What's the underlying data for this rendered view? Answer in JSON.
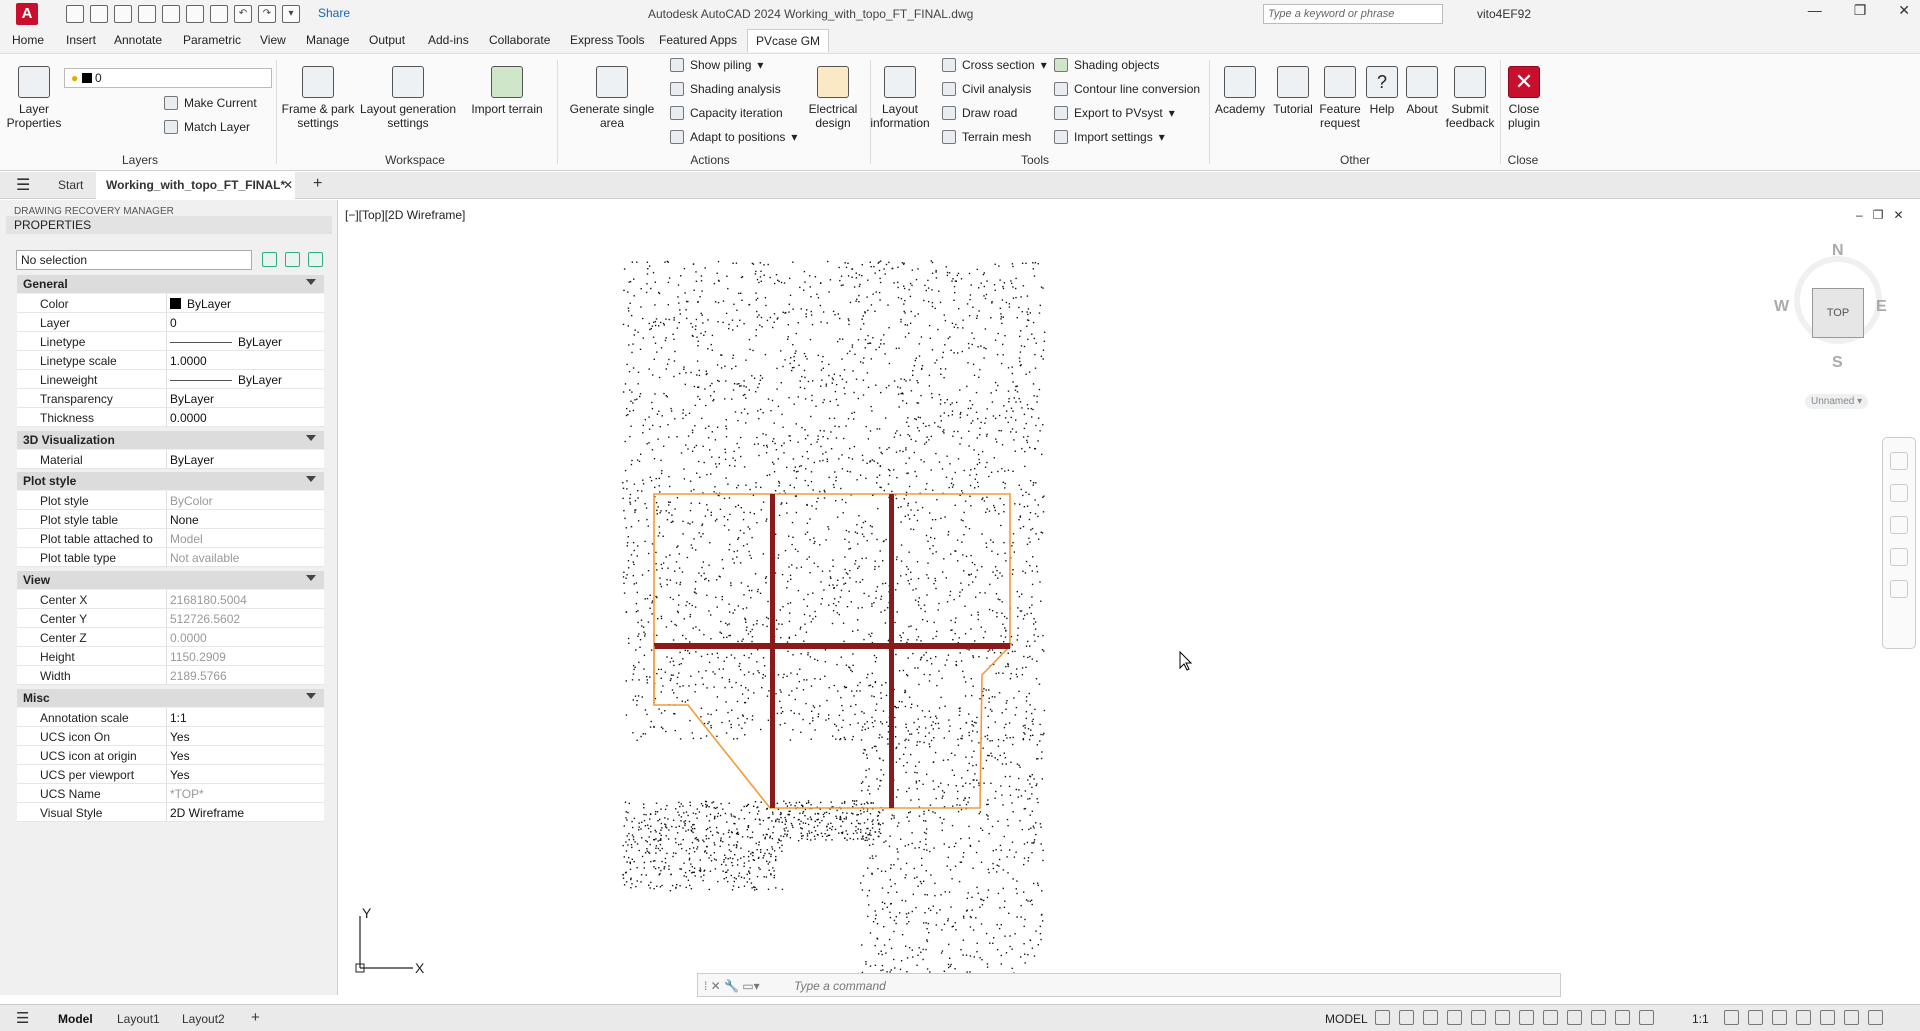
{
  "titlebar": {
    "app_letter": "A",
    "share_label": "Share",
    "title": "Autodesk AutoCAD 2024   Working_with_topo_FT_FINAL.dwg",
    "search_placeholder": "Type a keyword or phrase",
    "user": "vito4EF92"
  },
  "menu_tabs": [
    "Home",
    "Insert",
    "Annotate",
    "Parametric",
    "View",
    "Manage",
    "Output",
    "Add-ins",
    "Collaborate",
    "Express Tools",
    "Featured Apps",
    "PVcase GM"
  ],
  "active_menu_tab": "PVcase GM",
  "ribbon": {
    "layers": {
      "layer_properties": "Layer\nProperties",
      "current_layer": "0",
      "make_current": "Make Current",
      "match_layer": "Match Layer",
      "panel_title": "Layers"
    },
    "workspace": {
      "frame_park": "Frame & park\nsettings",
      "layout_generation": "Layout generation\nsettings",
      "import_terrain": "Import terrain",
      "panel_title": "Workspace"
    },
    "actions": {
      "generate_single_area": "Generate single\narea",
      "show_piling": "Show piling",
      "shading_analysis": "Shading analysis",
      "capacity_iteration": "Capacity iteration",
      "adapt_to_positions": "Adapt to positions",
      "electrical_design": "Electrical\ndesign",
      "panel_title": "Actions"
    },
    "tools": {
      "layout_information": "Layout\ninformation",
      "cross_section": "Cross section",
      "civil_analysis": "Civil analysis",
      "draw_road": "Draw road",
      "terrain_mesh": "Terrain mesh",
      "shading_objects": "Shading objects",
      "contour_line_conversion": "Contour line conversion",
      "export_to_pvsyst": "Export to PVsyst",
      "import_settings": "Import settings",
      "panel_title": "Tools"
    },
    "other": {
      "academy": "Academy",
      "tutorial": "Tutorial",
      "feature_request": "Feature\nrequest",
      "help": "Help",
      "about": "About",
      "submit_feedback": "Submit\nfeedback",
      "panel_title": "Other"
    },
    "close": {
      "close_plugin": "Close\nplugin",
      "panel_title": "Close"
    }
  },
  "file_tabs": {
    "start": "Start",
    "active": "Working_with_topo_FT_FINAL*"
  },
  "properties": {
    "drm": "DRAWING RECOVERY MANAGER",
    "header": "PROPERTIES",
    "selection": "No selection",
    "categories": {
      "general": "General",
      "viz": "3D Visualization",
      "plot": "Plot style",
      "view": "View",
      "misc": "Misc"
    },
    "rows": {
      "color": [
        "Color",
        "ByLayer"
      ],
      "layer": [
        "Layer",
        "0"
      ],
      "linetype": [
        "Linetype",
        "ByLayer"
      ],
      "ltscale": [
        "Linetype scale",
        "1.0000"
      ],
      "lineweight": [
        "Lineweight",
        "ByLayer"
      ],
      "transparency": [
        "Transparency",
        "ByLayer"
      ],
      "thickness": [
        "Thickness",
        "0.0000"
      ],
      "material": [
        "Material",
        "ByLayer"
      ],
      "plotstyle": [
        "Plot style",
        "ByColor"
      ],
      "plotstyletable": [
        "Plot style table",
        "None"
      ],
      "plottableattached": [
        "Plot table attached to",
        "Model"
      ],
      "plottabletype": [
        "Plot table type",
        "Not available"
      ],
      "centerx": [
        "Center X",
        "2168180.5004"
      ],
      "centery": [
        "Center Y",
        "512726.5602"
      ],
      "centerz": [
        "Center Z",
        "0.0000"
      ],
      "height": [
        "Height",
        "1150.2909"
      ],
      "width": [
        "Width",
        "2189.5766"
      ],
      "annoscale": [
        "Annotation scale",
        "1:1"
      ],
      "ucsiconon": [
        "UCS icon On",
        "Yes"
      ],
      "ucsiconorigin": [
        "UCS icon at origin",
        "Yes"
      ],
      "ucsperviewport": [
        "UCS per viewport",
        "Yes"
      ],
      "ucsname": [
        "UCS Name",
        "*TOP*"
      ],
      "visualstyle": [
        "Visual Style",
        "2D Wireframe"
      ]
    }
  },
  "viewport": {
    "label": "[−][Top][2D Wireframe]",
    "viewcube_face": "TOP",
    "dir_n": "N",
    "dir_s": "S",
    "dir_e": "E",
    "dir_w": "W",
    "named_view": "Unnamed",
    "ucs_x": "X",
    "ucs_y": "Y"
  },
  "command_line": {
    "placeholder": "Type a command"
  },
  "status_bar": {
    "model_tab": "Model",
    "layout1": "Layout1",
    "layout2": "Layout2",
    "space": "MODEL",
    "scale": "1:1"
  },
  "colors": {
    "boundary": "#f59a3a",
    "row": "#8b1a1a",
    "points": "#111111",
    "accent": "#c8102e"
  }
}
